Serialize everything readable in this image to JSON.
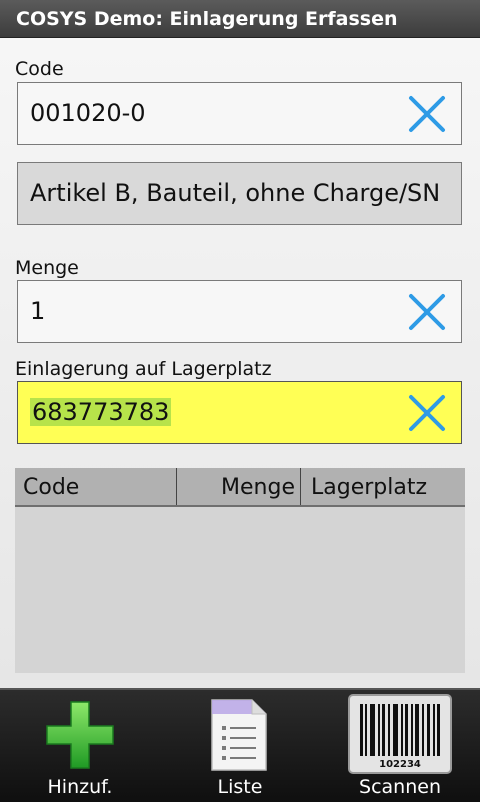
{
  "app": {
    "title": "COSYS Demo: Einlagerung Erfassen"
  },
  "form": {
    "code_label": "Code",
    "code_value": "001020-0",
    "description": "Artikel B, Bauteil, ohne Charge/SN",
    "menge_label": "Menge",
    "menge_value": "1",
    "lagerplatz_label": "Einlagerung auf Lagerplatz",
    "lagerplatz_value": "683773783"
  },
  "table": {
    "columns": [
      "Code",
      "Menge",
      "Lagerplatz"
    ],
    "rows": []
  },
  "bottom_nav": {
    "add_label": "Hinzuf.",
    "list_label": "Liste",
    "scan_label": "Scannen",
    "barcode_number": "102234"
  },
  "colors": {
    "clear_icon": "#2e9be6",
    "active_field": "#ffff55",
    "selection": "#b7e34a",
    "add_icon": "#3fb93f"
  }
}
